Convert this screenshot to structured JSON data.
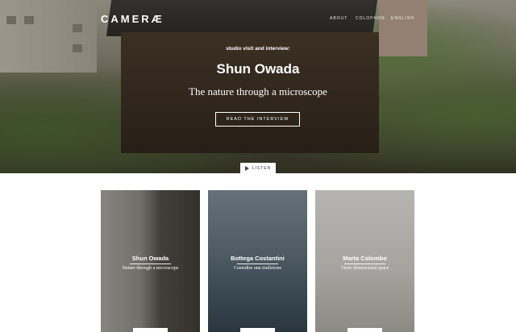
{
  "header": {
    "brand": "CAMERÆ",
    "nav": [
      "ABOUT",
      "COLOPHON",
      "ENGLISH"
    ]
  },
  "hero": {
    "kicker": "studio visit and interview:",
    "title": "Shun Owada",
    "subtitle": "The nature through a microscope",
    "cta_label": "READ THE INTERVIEW",
    "listen_label": "LISTEN"
  },
  "cards": [
    {
      "name": "Shun Owada",
      "subtitle": "Nature through a microscope"
    },
    {
      "name": "Bottega Costantini",
      "subtitle": "Custodire una tradizione"
    },
    {
      "name": "Marta Colombo",
      "subtitle": "Three dimensional space"
    }
  ]
}
